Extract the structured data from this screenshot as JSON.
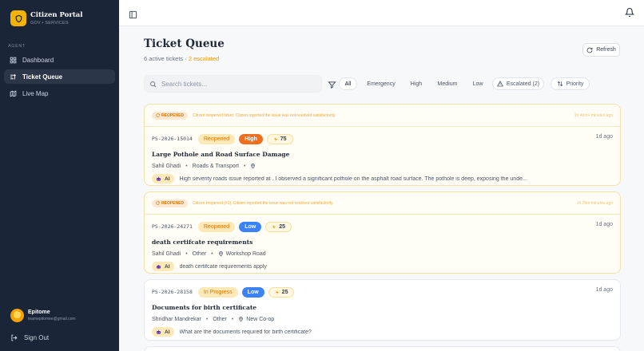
{
  "brand": {
    "title": "Citizen Portal",
    "subtitle": "GOV • SERVICES"
  },
  "sidebar": {
    "section_label": "AGENT",
    "items": [
      {
        "label": "Dashboard",
        "icon": "grid-icon"
      },
      {
        "label": "Ticket Queue",
        "icon": "list-filter-icon",
        "active": true
      },
      {
        "label": "Live Map",
        "icon": "map-icon"
      }
    ],
    "user": {
      "name": "Epitome",
      "email": "teamepitomee@gmail.com"
    },
    "signout_label": "Sign Out"
  },
  "header": {
    "title": "Ticket Queue",
    "active_count": "6 active tickets",
    "separator": " · ",
    "escalated": "2 escalated",
    "refresh_label": "Refresh"
  },
  "search": {
    "placeholder": "Search tickets...",
    "value": ""
  },
  "filters": {
    "all": "All",
    "emergency": "Emergency",
    "high": "High",
    "medium": "Medium",
    "low": "Low",
    "escalated": "Escalated (2)",
    "priority": "Priority"
  },
  "tickets": [
    {
      "banner_tag": "REOPENED",
      "banner_text": "Citizen reopened ticket: Citizen reported the issue was not resolved satisfactorily.",
      "banner_time": "1h 40m+ minutes ago",
      "id": "PS-2026-15014",
      "status": "Reopened",
      "priority": "High",
      "score": "75",
      "time_ago": "1d ago",
      "title": "Large Pothole and Road Surface Damage",
      "reporter": "Sahil Ghadi",
      "category": "Roads & Transport",
      "location": "",
      "ai_label": "AI",
      "ai_summary": "High severity roads issue reported at . I observed a significant pothole on the asphalt road surface. The pothole is deep, exposing the unde..."
    },
    {
      "banner_tag": "REOPENED",
      "banner_text": "Citizen reopened (#1): Citizen reported the issue was not resolved satisfactorily.",
      "banner_time": "1h 29m minutes ago",
      "id": "PS-2026-24271",
      "status": "Reopened",
      "priority": "Low",
      "score": "25",
      "time_ago": "1d ago",
      "title": "death certifcate requirements",
      "reporter": "Sahil Ghadi",
      "category": "Other",
      "location": "Workshop Road",
      "ai_label": "AI",
      "ai_summary": "death certifcate requirements apply"
    },
    {
      "id": "PS-2026-28158",
      "status": "In Progress",
      "priority": "Low",
      "score": "25",
      "time_ago": "1d ago",
      "title": "Documents for birth certificate",
      "reporter": "Shridhar Mandrekar",
      "category": "Other",
      "location": "New Co-op",
      "ai_label": "AI",
      "ai_summary": "What are the documents required for birth certificate?"
    }
  ],
  "colors": {
    "sidebar_bg": "#1b2538",
    "accent": "#f5b301",
    "high": "#f06f1f",
    "low": "#3b82f6",
    "escalated": "#e59b0a"
  }
}
